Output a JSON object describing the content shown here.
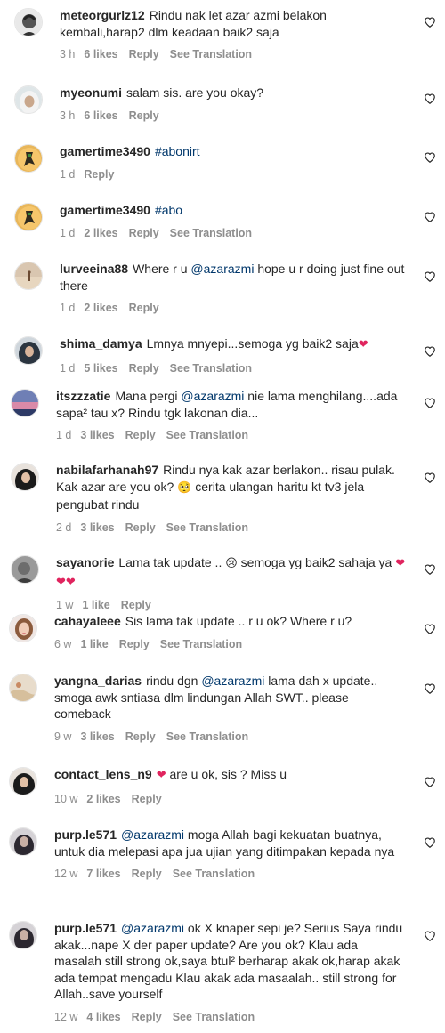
{
  "icons": {
    "like": "heart-outline-icon"
  },
  "comments": [
    {
      "user": "meteorgurlz12",
      "segments": [
        {
          "t": "Rindu nak let azar azmi belakon kembali,harap2 dlm keadaan baik2 saja"
        }
      ],
      "time": "3 h",
      "likes": "6 likes",
      "reply": "Reply",
      "translate": "See Translation",
      "avatar": "meteor"
    },
    {
      "user": "myeonumi",
      "segments": [
        {
          "t": "salam sis. are you okay?"
        }
      ],
      "time": "3 h",
      "likes": "6 likes",
      "reply": "Reply",
      "translate": "",
      "avatar": "hijab-white"
    },
    {
      "user": "gamertime3490",
      "segments": [
        {
          "t": "#abonirt",
          "k": "tag"
        }
      ],
      "time": "1 d",
      "likes": "",
      "reply": "Reply",
      "translate": "",
      "avatar": "gamer"
    },
    {
      "user": "gamertime3490",
      "segments": [
        {
          "t": "#abo",
          "k": "tag"
        }
      ],
      "time": "1 d",
      "likes": "2 likes",
      "reply": "Reply",
      "translate": "See Translation",
      "avatar": "gamer"
    },
    {
      "user": "lurveeina88",
      "segments": [
        {
          "t": "Where r u "
        },
        {
          "t": "@azarazmi",
          "k": "mention"
        },
        {
          "t": " hope u r doing just fine out there"
        }
      ],
      "time": "1 d",
      "likes": "2 likes",
      "reply": "Reply",
      "translate": "",
      "avatar": "beach"
    },
    {
      "user": "shima_damya",
      "segments": [
        {
          "t": "Lmnya mnyepi...semoga yg baik2 saja"
        },
        {
          "t": "❤",
          "k": "emoji-red"
        }
      ],
      "time": "1 d",
      "likes": "5 likes",
      "reply": "Reply",
      "translate": "See Translation",
      "avatar": "hijab-dark"
    },
    {
      "user": "itszzzatie",
      "segments": [
        {
          "t": "Mana pergi "
        },
        {
          "t": "@azarazmi",
          "k": "mention"
        },
        {
          "t": " nie lama menghilang....ada sapa² tau x? Rindu tgk lakonan dia..."
        }
      ],
      "time": "1 d",
      "likes": "3 likes",
      "reply": "Reply",
      "translate": "See Translation",
      "avatar": "sunset"
    },
    {
      "user": "nabilafarhanah97",
      "segments": [
        {
          "t": "Rindu nya kak azar berlakon.. risau pulak. Kak azar are you ok? "
        },
        {
          "t": "🥺",
          "k": "emoji"
        },
        {
          "t": " cerita ulangan haritu kt tv3 jela pengubat rindu"
        }
      ],
      "time": "2 d",
      "likes": "3 likes",
      "reply": "Reply",
      "translate": "See Translation",
      "avatar": "hijab-black"
    },
    {
      "user": "sayanorie",
      "segments": [
        {
          "t": "Lama tak update .. "
        },
        {
          "t": "😢",
          "k": "emoji"
        },
        {
          "t": " semoga yg baik2 sahaja ya "
        },
        {
          "t": "❤❤❤",
          "k": "emoji-red"
        }
      ],
      "time": "1 w",
      "likes": "1 like",
      "reply": "Reply",
      "translate": "",
      "avatar": "grey"
    },
    {
      "user": "cahayaleee",
      "segments": [
        {
          "t": "Sis lama tak update .. r u ok? Where r u?"
        }
      ],
      "time": "6 w",
      "likes": "1 like",
      "reply": "Reply",
      "translate": "See Translation",
      "avatar": "girl"
    },
    {
      "user": "yangna_darias",
      "segments": [
        {
          "t": "rindu dgn "
        },
        {
          "t": "@azarazmi",
          "k": "mention"
        },
        {
          "t": " lama dah x update.. smoga awk sntiasa dlm lindungan Allah SWT.. please comeback"
        }
      ],
      "time": "9 w",
      "likes": "3 likes",
      "reply": "Reply",
      "translate": "See Translation",
      "avatar": "sand"
    },
    {
      "user": "contact_lens_n9",
      "segments": [
        {
          "t": "❤",
          "k": "emoji-red"
        },
        {
          "t": " are u ok, sis ? Miss u"
        }
      ],
      "time": "10 w",
      "likes": "2 likes",
      "reply": "Reply",
      "translate": "",
      "avatar": "hijab-black"
    },
    {
      "user": "purp.le571",
      "segments": [
        {
          "t": "@azarazmi",
          "k": "mention"
        },
        {
          "t": " moga Allah bagi kekuatan buatnya, untuk dia melepasi apa jua ujian yang ditimpakan kepada nya"
        }
      ],
      "time": "12 w",
      "likes": "7 likes",
      "reply": "Reply",
      "translate": "See Translation",
      "avatar": "purp"
    },
    {
      "user": "purp.le571",
      "segments": [
        {
          "t": "@azarazmi",
          "k": "mention"
        },
        {
          "t": " ok X knaper sepi je? Serius Saya rindu akak...nape X der paper update? Are you ok? Klau ada masalah still strong ok,saya btul² berharap akak ok,harap akak ada tempat mengadu Klau akak ada masaalah.. still strong for Allah..save yourself"
        }
      ],
      "time": "12 w",
      "likes": "4 likes",
      "reply": "Reply",
      "translate": "See Translation",
      "avatar": "purp"
    }
  ]
}
